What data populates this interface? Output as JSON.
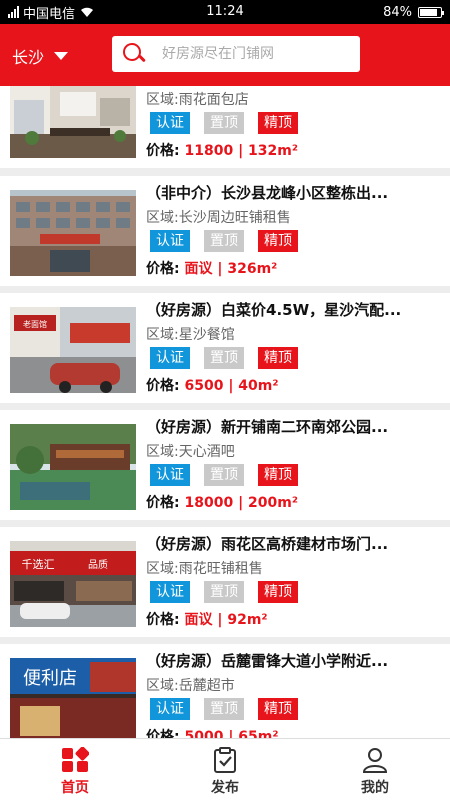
{
  "status_bar": {
    "carrier": "中国电信",
    "time": "11:24",
    "battery": "84%",
    "battery_level": 0.84
  },
  "header": {
    "city": "长沙",
    "search_placeholder": "好房源尽在门铺网"
  },
  "listings": [
    {
      "title": "",
      "region": "区域:雨花面包店",
      "price_label": "价格:",
      "price_value": "11800 | 132m²"
    },
    {
      "title": "（非中介）长沙县龙峰小区整栋出...",
      "region": "区域:长沙周边旺铺租售",
      "price_label": "价格:",
      "price_value": "面议 | 326m²"
    },
    {
      "title": "（好房源）白菜价4.5W，星沙汽配...",
      "region": "区域:星沙餐馆",
      "price_label": "价格:",
      "price_value": "6500 | 40m²"
    },
    {
      "title": "（好房源）新开铺南二环南郊公园...",
      "region": "区域:天心酒吧",
      "price_label": "价格:",
      "price_value": "18000 | 200m²"
    },
    {
      "title": "（好房源）雨花区高桥建材市场门...",
      "region": "区域:雨花旺铺租售",
      "price_label": "价格:",
      "price_value": "面议 | 92m²"
    },
    {
      "title": "（好房源）岳麓雷锋大道小学附近...",
      "region": "区域:岳麓超市",
      "price_label": "价格:",
      "price_value": "5000 | 65m²"
    }
  ],
  "tags": {
    "verified": "认证",
    "pinned": "置顶",
    "premium": "精顶"
  },
  "photo_signs": {
    "listing3": "老面馆",
    "listing5_a": "千选汇",
    "listing5_b": "品质",
    "listing6": "便利店"
  },
  "nav": {
    "home": "首页",
    "publish": "发布",
    "mine": "我的"
  },
  "colors": {
    "brand_red": "#e8141b",
    "verified_blue": "#1296db",
    "pinned_gray": "#c9c9c9"
  }
}
